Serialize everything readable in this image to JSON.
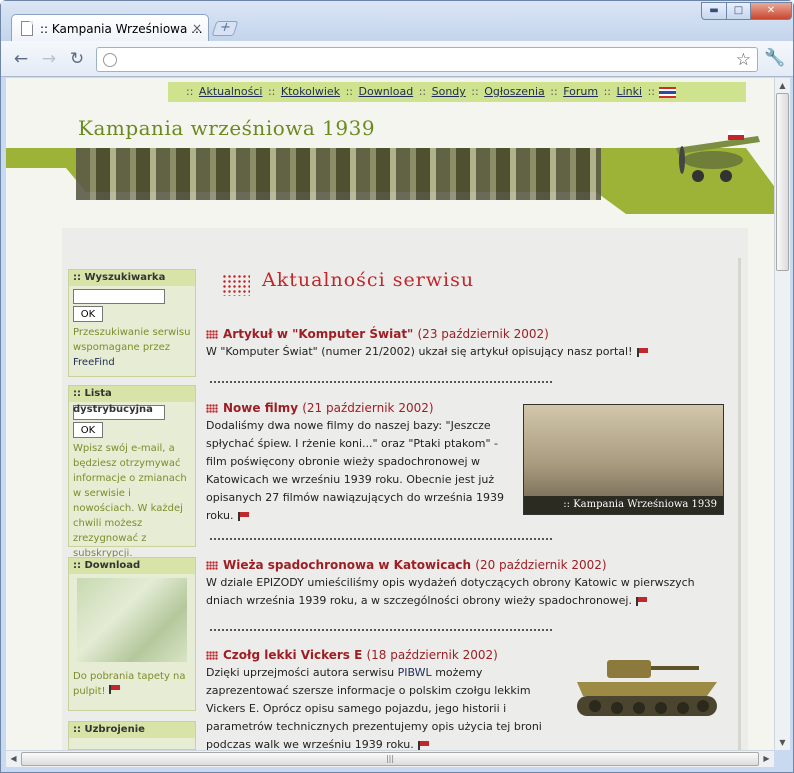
{
  "browser": {
    "tab_title": ":: Kampania Wrześniowa ...",
    "tab_close": "×",
    "new_tab": "+",
    "minimize": "▬",
    "maximize": "□",
    "close": "✕",
    "back": "←",
    "forward": "→",
    "reload": "↻",
    "star": "☆",
    "wrench": "🔧",
    "icons": {
      "back": "arrow-left-icon",
      "forward": "arrow-right-icon",
      "reload": "reload-icon",
      "star": "star-icon",
      "wrench": "wrench-icon",
      "globe": "globe-icon"
    }
  },
  "site": {
    "title": "Kampania wrześniowa 1939",
    "menu_sep": "::",
    "menu": [
      "Aktualności",
      "Ktokolwiek",
      "Download",
      "Sondy",
      "Ogłoszenia",
      "Forum",
      "Linki"
    ],
    "headline": "Aktualności serwisu"
  },
  "sidebar": {
    "search": {
      "title": ":: Wyszukiwarka",
      "button": "OK",
      "text": "Przeszukiwanie serwisu wspomagane przez",
      "link": "FreeFind"
    },
    "list": {
      "title": ":: Lista dystrybucyjna",
      "button": "OK",
      "text": "Wpisz swój e-mail, a będziesz otrzymywać informacje o zmianach w serwisie i nowościach. W każdej chwili możesz zrezygnować z subskrypcji."
    },
    "download": {
      "title": "::   Download",
      "text": "Do pobrania tapety na pulpit!"
    },
    "weapons": {
      "title": ":: Uzbrojenie"
    }
  },
  "news": [
    {
      "title": "Artykuł w \"Komputer Świat\"",
      "date": "(23 październik 2002)",
      "body": "W \"Komputer Świat\" (numer 21/2002) ukzał się artykuł opisujący nasz portal!"
    },
    {
      "title": "Nowe filmy",
      "date": "(21 październik 2002)",
      "body": "Dodaliśmy dwa nowe filmy do naszej bazy: \"Jeszcze spłychać śpiew. I rżenie koni...\" oraz \"Ptaki ptakom\" - film poświęcony obronie wieży spadochronowej w Katowicach we wrześniu 1939 roku. Obecnie jest już opisanych 27 filmów nawiązujących do września 1939 roku.",
      "image_caption": ":: Kampania Wrześniowa 1939"
    },
    {
      "title": "Wieża spadochronowa w Katowicach",
      "date": "(20 październik 2002)",
      "body": "W dziale EPIZODY umieściliśmy opis wydażeń dotyczących obrony Katowic w pierwszych dniach września 1939 roku, a w szczególności obrony wieży spadochronowej."
    },
    {
      "title": "Czołg lekki Vickers E",
      "date": "(18 październik 2002)",
      "body_pre": "Dzięki uprzejmości autora serwisu",
      "link": "PIBWL",
      "body_post": "możemy zaprezentować szersze informacje o polskim czołgu lekkim Vickers E. Oprócz opisu samego pojazdu, jego historii i parametrów technicznych prezentujemy opis użycia tej broni podczas walk we wrześniu 1939 roku."
    }
  ]
}
